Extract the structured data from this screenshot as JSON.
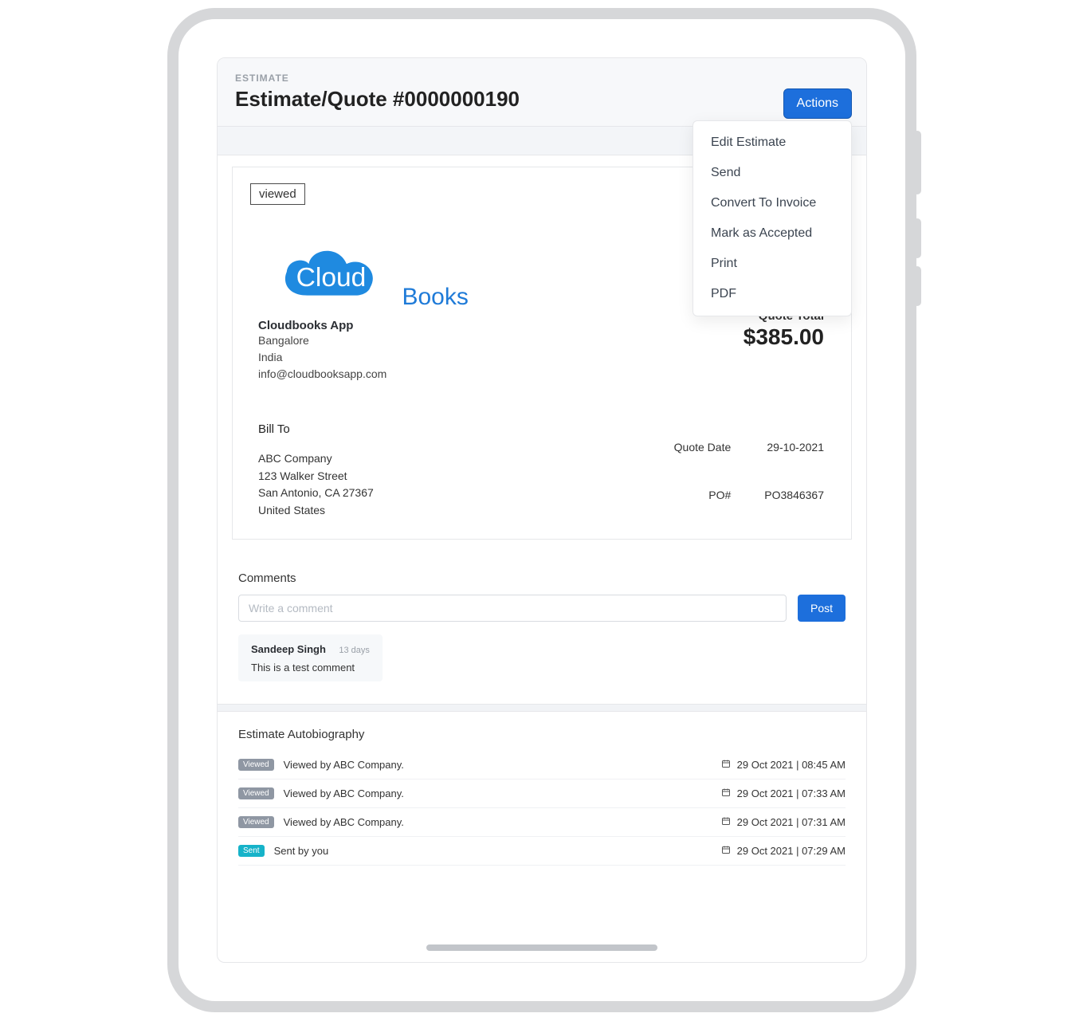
{
  "header": {
    "eyebrow": "ESTIMATE",
    "title": "Estimate/Quote #0000000190",
    "actions_label": "Actions"
  },
  "actions_menu": {
    "items": [
      "Edit Estimate",
      "Send",
      "Convert To Invoice",
      "Mark as Accepted",
      "Print",
      "PDF"
    ]
  },
  "document": {
    "status_badge": "viewed",
    "logo": {
      "left": "Cloud",
      "right": "Books"
    },
    "company": {
      "name": "Cloudbooks App",
      "city": "Bangalore",
      "country": "India",
      "email": "info@cloudbooksapp.com"
    },
    "quote_total": {
      "label": "Quote Total",
      "value": "$385.00"
    },
    "bill_to": {
      "heading": "Bill To",
      "name": "ABC Company",
      "line1": "123 Walker Street",
      "line2": "San Antonio, CA 27367",
      "line3": "United States"
    },
    "meta": {
      "quote_date_label": "Quote Date",
      "quote_date_value": "29-10-2021",
      "po_label": "PO#",
      "po_value": "PO3846367"
    }
  },
  "comments": {
    "heading": "Comments",
    "placeholder": "Write a comment",
    "post_label": "Post",
    "existing": {
      "author": "Sandeep Singh",
      "age": "13 days",
      "body": "This is a test comment"
    }
  },
  "autobiography": {
    "heading": "Estimate Autobiography",
    "rows": [
      {
        "pill": "Viewed",
        "pill_class": "viewed",
        "text": "Viewed by ABC Company.",
        "date": "29 Oct 2021 | 08:45 AM"
      },
      {
        "pill": "Viewed",
        "pill_class": "viewed",
        "text": "Viewed by ABC Company.",
        "date": "29 Oct 2021 | 07:33 AM"
      },
      {
        "pill": "Viewed",
        "pill_class": "viewed",
        "text": "Viewed by ABC Company.",
        "date": "29 Oct 2021 | 07:31 AM"
      },
      {
        "pill": "Sent",
        "pill_class": "sent",
        "text": "Sent by you",
        "date": "29 Oct 2021 | 07:29 AM"
      }
    ]
  }
}
